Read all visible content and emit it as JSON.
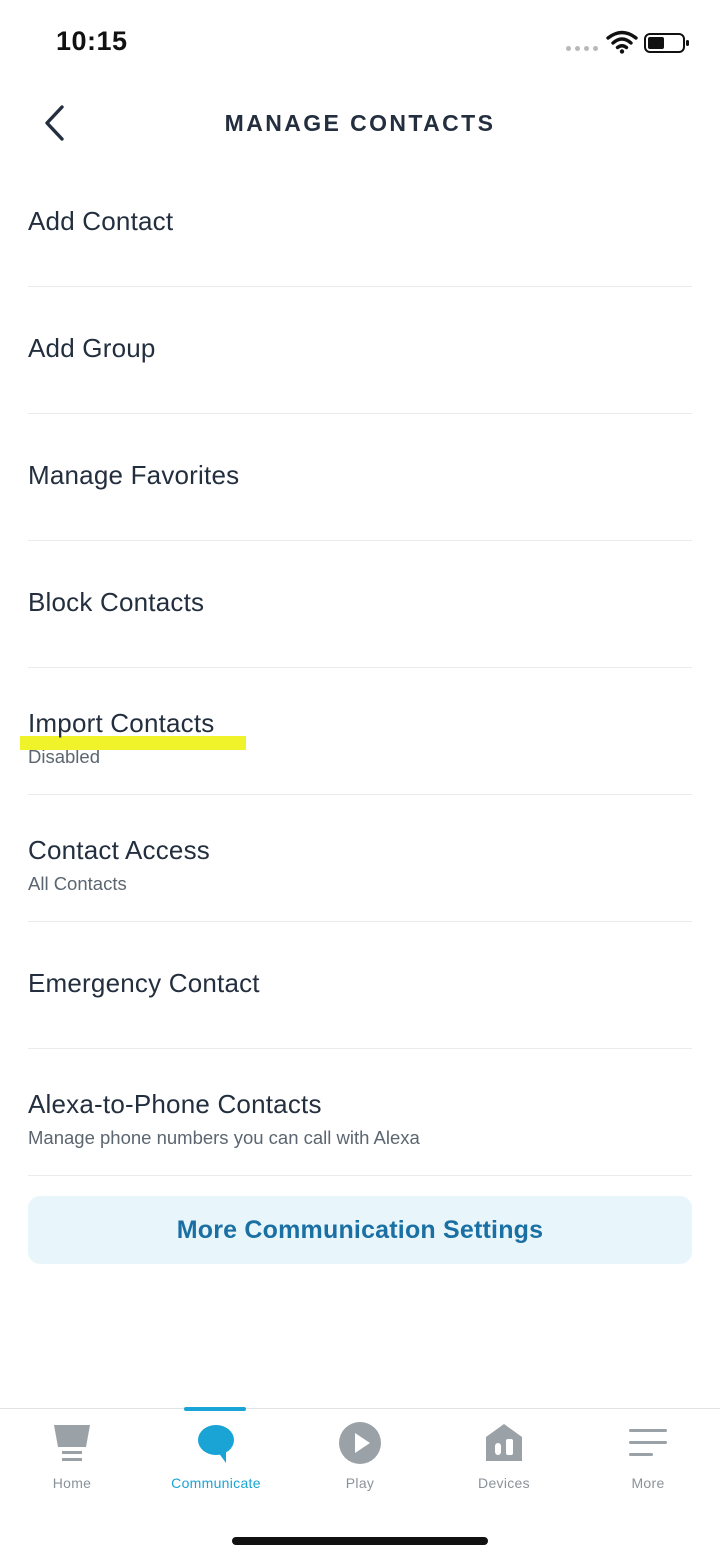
{
  "status_bar": {
    "time": "10:15"
  },
  "header": {
    "title": "MANAGE CONTACTS"
  },
  "list_items": [
    {
      "title": "Add Contact",
      "subtitle": ""
    },
    {
      "title": "Add Group",
      "subtitle": ""
    },
    {
      "title": "Manage Favorites",
      "subtitle": ""
    },
    {
      "title": "Block Contacts",
      "subtitle": ""
    },
    {
      "title": "Import Contacts",
      "subtitle": "Disabled"
    },
    {
      "title": "Contact Access",
      "subtitle": "All Contacts"
    },
    {
      "title": "Emergency Contact",
      "subtitle": ""
    },
    {
      "title": "Alexa-to-Phone Contacts",
      "subtitle": "Manage phone numbers you can call with Alexa"
    }
  ],
  "cta": {
    "label": "More Communication Settings"
  },
  "tab_bar": {
    "active_tab": "Communicate",
    "tabs": [
      {
        "label": "Home",
        "icon": "home-icon"
      },
      {
        "label": "Communicate",
        "icon": "speech-bubble-icon"
      },
      {
        "label": "Play",
        "icon": "play-icon"
      },
      {
        "label": "Devices",
        "icon": "devices-icon"
      },
      {
        "label": "More",
        "icon": "hamburger-menu-icon"
      }
    ]
  },
  "colors": {
    "accent": "#1aa4d6",
    "cta_text": "#1a6fa3",
    "cta_background": "#e8f6fc",
    "highlight": "#f0f32a",
    "inactive_tab": "#8a9299"
  }
}
